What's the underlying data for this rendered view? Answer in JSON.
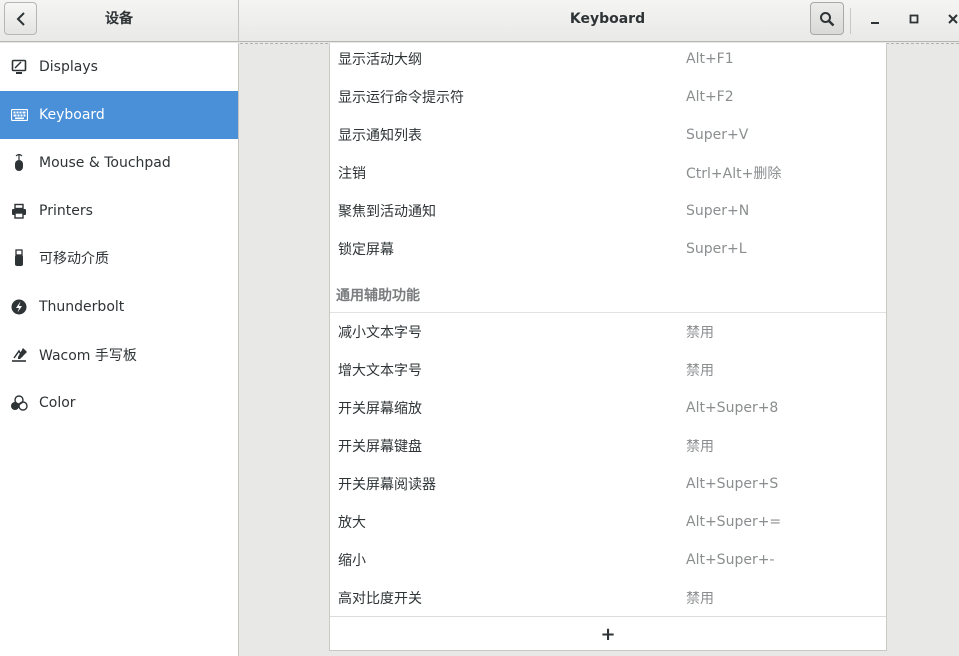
{
  "header": {
    "left_title": "设备",
    "title": "Keyboard"
  },
  "sidebar": {
    "items": [
      {
        "label": "Displays",
        "icon": "display-icon"
      },
      {
        "label": "Keyboard",
        "icon": "keyboard-icon",
        "active": true
      },
      {
        "label": "Mouse & Touchpad",
        "icon": "mouse-icon"
      },
      {
        "label": "Printers",
        "icon": "printer-icon"
      },
      {
        "label": "可移动介质",
        "icon": "usb-drive-icon"
      },
      {
        "label": "Thunderbolt",
        "icon": "thunderbolt-icon"
      },
      {
        "label": "Wacom 手写板",
        "icon": "tablet-icon"
      },
      {
        "label": "Color",
        "icon": "color-icon"
      }
    ]
  },
  "shortcuts": {
    "group1": [
      {
        "name": "显示活动大纲",
        "accel": "Alt+F1"
      },
      {
        "name": "显示运行命令提示符",
        "accel": "Alt+F2"
      },
      {
        "name": "显示通知列表",
        "accel": "Super+V"
      },
      {
        "name": "注销",
        "accel": "Ctrl+Alt+删除"
      },
      {
        "name": "聚焦到活动通知",
        "accel": "Super+N"
      },
      {
        "name": "锁定屏幕",
        "accel": "Super+L"
      }
    ],
    "section_title": "通用辅助功能",
    "group2": [
      {
        "name": "减小文本字号",
        "accel": "禁用"
      },
      {
        "name": "增大文本字号",
        "accel": "禁用"
      },
      {
        "name": "开关屏幕缩放",
        "accel": "Alt+Super+8"
      },
      {
        "name": "开关屏幕键盘",
        "accel": "禁用"
      },
      {
        "name": "开关屏幕阅读器",
        "accel": "Alt+Super+S"
      },
      {
        "name": "放大",
        "accel": "Alt+Super+="
      },
      {
        "name": "缩小",
        "accel": "Alt+Super+-"
      },
      {
        "name": "高对比度开关",
        "accel": "禁用"
      }
    ],
    "add_label": "+"
  },
  "colors": {
    "accent": "#4a90d9",
    "accel_text": "#8b8e8f",
    "section_text": "#7a7d7e"
  }
}
